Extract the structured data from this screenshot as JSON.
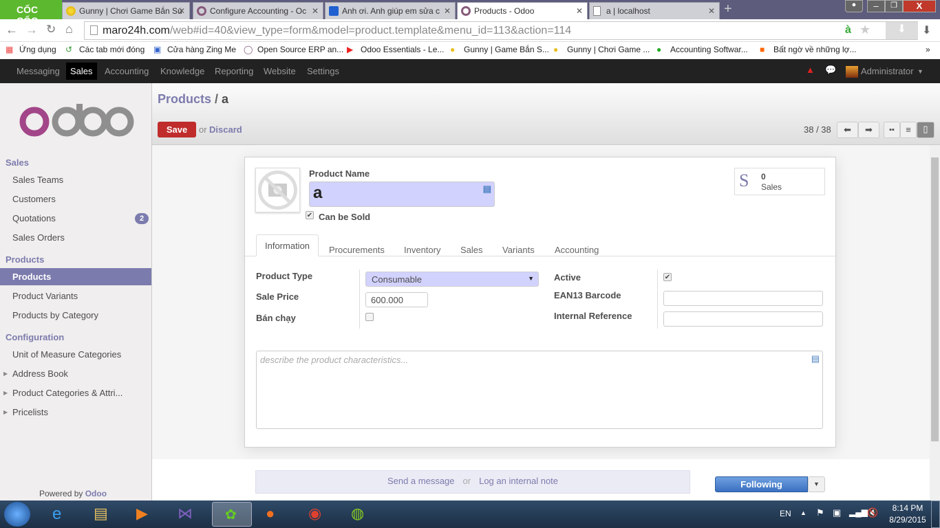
{
  "browser": {
    "brand": "CỐC CỐC",
    "tabs": [
      {
        "label": "Gunny | Chơi Game Bắn Sú"
      },
      {
        "label": "Configure Accounting - Oc"
      },
      {
        "label": "Anh ơi. Anh giúp em sửa c"
      },
      {
        "label": "Products - Odoo",
        "active": true
      },
      {
        "label": "a | localhost"
      }
    ],
    "url_host": "maro24h.com",
    "url_path": "/web#id=40&view_type=form&model=product.template&menu_id=113&action=114",
    "bookmarks": [
      "Ứng dụng",
      "Các tab mới đóng",
      "Cửa hàng Zing Me",
      "Open Source ERP an...",
      "Odoo Essentials - Le...",
      "Gunny | Game Bắn S...",
      "Gunny | Chơi Game ...",
      "Accounting Softwar...",
      "Bất ngờ về những lợ..."
    ],
    "more": "»"
  },
  "topnav": {
    "items": [
      "Messaging",
      "Sales",
      "Accounting",
      "Knowledge",
      "Reporting",
      "Website",
      "Settings"
    ],
    "active": "Sales",
    "user": "Administrator"
  },
  "sidebar": {
    "sections": [
      {
        "title": "Sales",
        "items": [
          {
            "label": "Sales Teams"
          },
          {
            "label": "Customers"
          },
          {
            "label": "Quotations",
            "badge": "2"
          },
          {
            "label": "Sales Orders"
          }
        ]
      },
      {
        "title": "Products",
        "items": [
          {
            "label": "Products",
            "active": true
          },
          {
            "label": "Product Variants"
          },
          {
            "label": "Products by Category"
          }
        ]
      },
      {
        "title": "Configuration",
        "items": [
          {
            "label": "Unit of Measure Categories"
          },
          {
            "label": "Address Book"
          },
          {
            "label": "Product Categories & Attri..."
          },
          {
            "label": "Pricelists"
          }
        ]
      }
    ],
    "powered_by": "Powered by",
    "powered_brand": "Odoo"
  },
  "header": {
    "breadcrumb_parent": "Products",
    "breadcrumb_sep": " / ",
    "breadcrumb_current": "a",
    "save": "Save",
    "or": "or",
    "discard": "Discard",
    "pager": "38 / 38"
  },
  "form": {
    "product_name_label": "Product Name",
    "product_name": "a",
    "can_be_sold_label": "Can be Sold",
    "can_be_sold": true,
    "sales_count": "0",
    "sales_label": "Sales",
    "tabs": [
      "Information",
      "Procurements",
      "Inventory",
      "Sales",
      "Variants",
      "Accounting"
    ],
    "active_tab": "Information",
    "product_type_label": "Product Type",
    "product_type": "Consumable",
    "sale_price_label": "Sale Price",
    "sale_price": "600.000",
    "ban_chay_label": "Bán chạy",
    "ban_chay": false,
    "active_label": "Active",
    "active": true,
    "ean13_label": "EAN13 Barcode",
    "ean13": "",
    "internal_ref_label": "Internal Reference",
    "internal_ref": "",
    "description_placeholder": "describe the product characteristics..."
  },
  "chatter": {
    "send_message": "Send a message",
    "or": "or",
    "log_note": "Log an internal note",
    "following": "Following"
  },
  "taskbar": {
    "lang": "EN",
    "time": "8:14 PM",
    "date": "8/29/2015"
  },
  "colors": {
    "brand": "#7c7bad",
    "save": "#c02c2c",
    "nav": "#222222",
    "required": "#d2d2ff"
  }
}
